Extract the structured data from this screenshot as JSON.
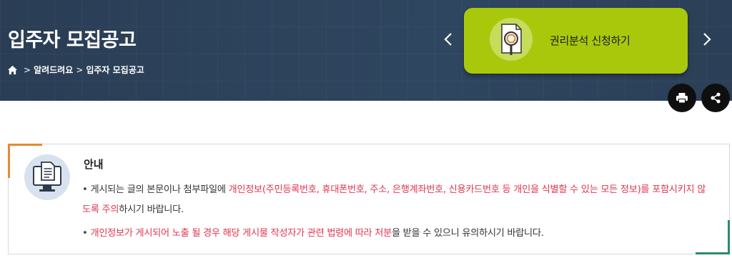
{
  "header": {
    "title": "입주자 모집공고",
    "breadcrumb": [
      "알려드려요",
      "입주자 모집공고"
    ]
  },
  "banner": {
    "label": "권리분석 신청하기",
    "icon": "document-magnifier-icon"
  },
  "actions": {
    "print_icon": "printer-icon",
    "share_icon": "share-icon"
  },
  "notice": {
    "title": "안내",
    "items": [
      {
        "bullet": "•",
        "pre": "게시되는 글의 본문이나 첨부파일에 ",
        "highlight": "개인정보(주민등록번호, 휴대폰번호, 주소, 은행계좌번호, 신용카드번호 등 개인을 식별할 수 있는 모든 정보)를 포함시키지 않도록 주의",
        "post": "하시기 바랍니다."
      },
      {
        "bullet": "•",
        "highlight_a": "개인정보가 게시되어 노출 될 경우 해당 게시물 작성자가 관련 법령에 따라 처분",
        "post": "을 받을 수 있으니 유의하시기 바랍니다."
      }
    ]
  },
  "colors": {
    "hero_bg": "#2c4057",
    "banner_bg": "#a9c80b",
    "accent_orange": "#e58a2c",
    "accent_green": "#2c8a70",
    "warning_red": "#e2354f"
  }
}
